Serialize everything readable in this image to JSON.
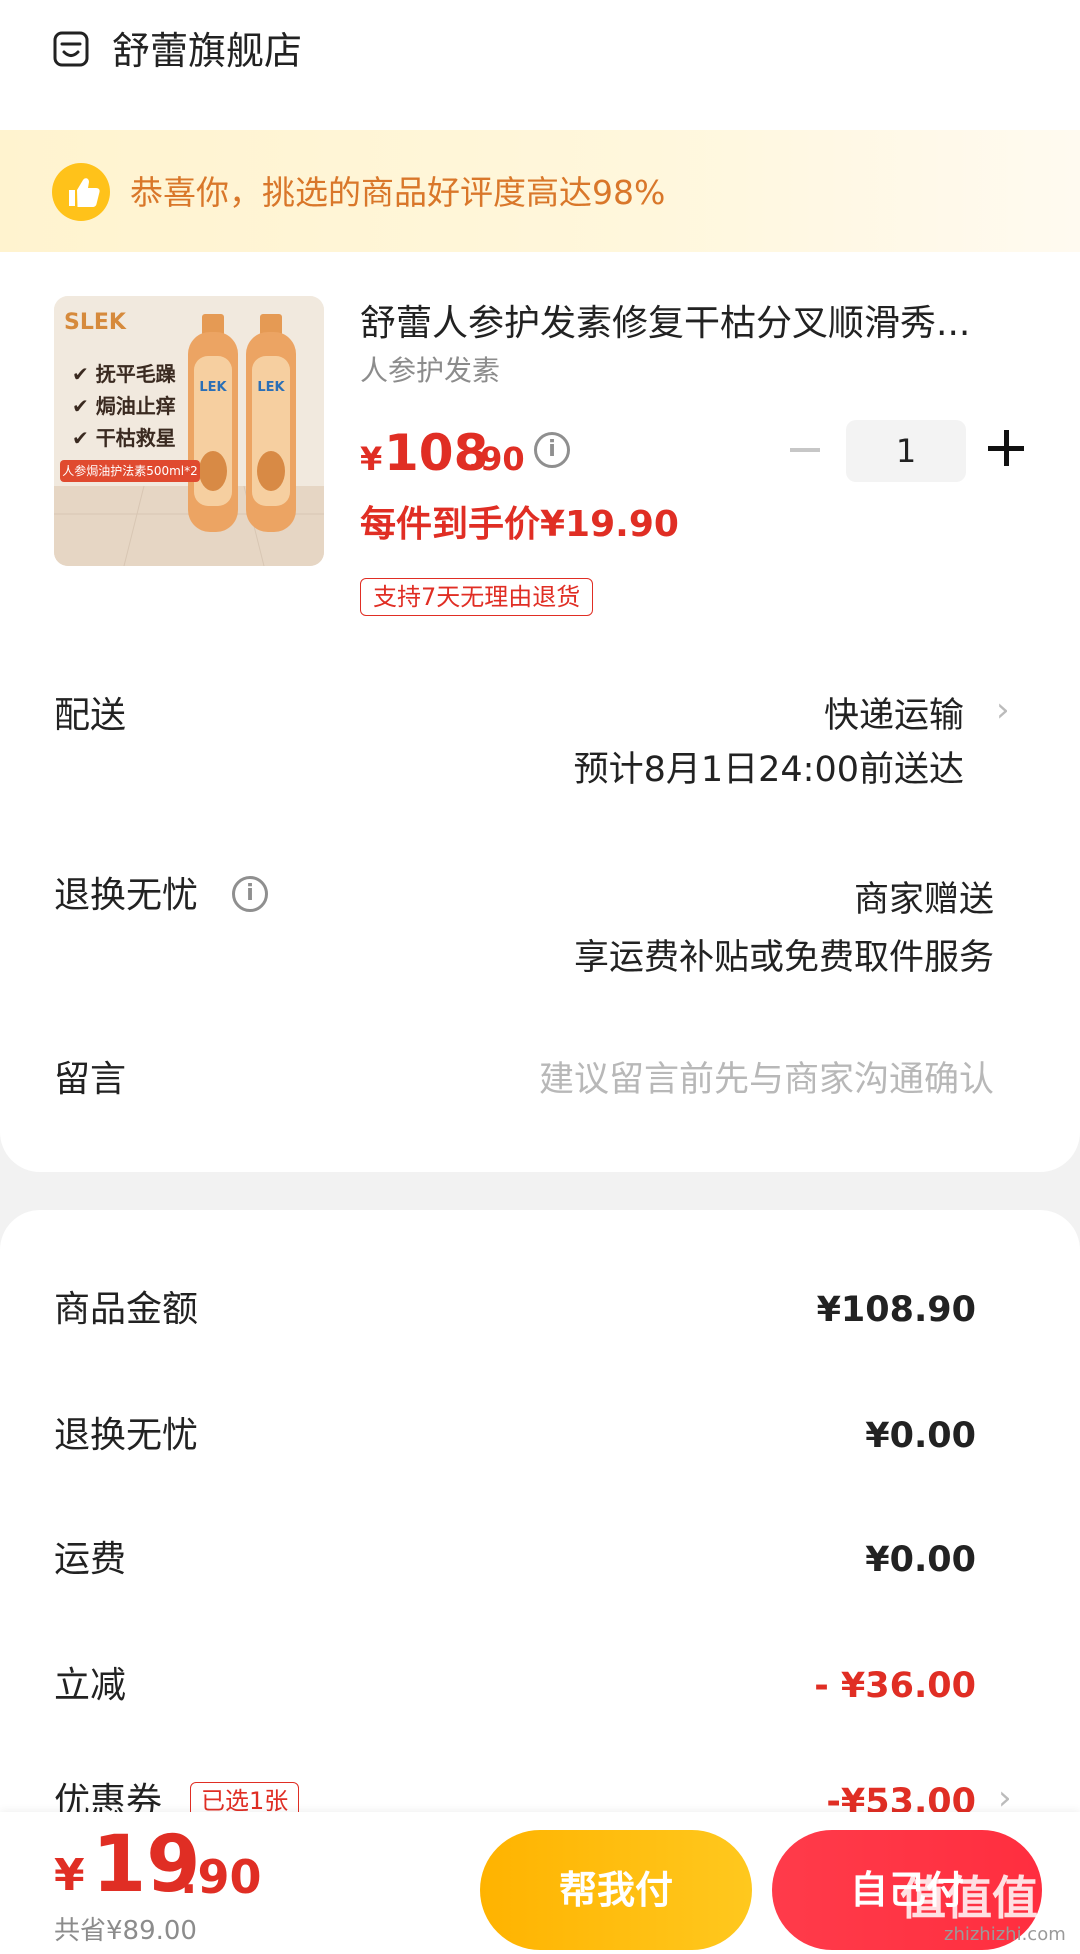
{
  "store": {
    "name": "舒蕾旗舰店",
    "icon": "store-icon"
  },
  "banner": {
    "text": "恭喜你，挑选的商品好评度高达98%",
    "icon": "thumbs-up-icon"
  },
  "product": {
    "title": "舒蕾人参护发素修复干枯分叉顺滑秀...",
    "spec": "人参护发素",
    "price_symbol": "¥",
    "price_int": "108",
    "price_dec": ".90",
    "quantity": "1",
    "unit_price": "每件到手价¥19.90",
    "return_tag": "支持7天无理由退货",
    "image": {
      "brand": "SLEK",
      "bullets": [
        "抚平毛躁",
        "焗油止痒",
        "干枯救星"
      ],
      "strip": "人参焗油护法素500ml*2"
    }
  },
  "delivery": {
    "label": "配送",
    "method": "快递运输",
    "eta": "预计8月1日24:00前送达"
  },
  "return_worry": {
    "label": "退换无忧",
    "value": "商家赠送",
    "desc": "享运费补贴或免费取件服务"
  },
  "message": {
    "label": "留言",
    "placeholder": "建议留言前先与商家沟通确认"
  },
  "summary": {
    "rows": [
      {
        "label": "商品金额",
        "value": "¥108.90"
      },
      {
        "label": "退换无忧",
        "value": "¥0.00"
      },
      {
        "label": "运费",
        "value": "¥0.00"
      },
      {
        "label": "立减",
        "value": "- ¥36.00"
      },
      {
        "label": "优惠券",
        "tag": "已选1张",
        "value": "-¥53.00"
      }
    ]
  },
  "bottom": {
    "total_symbol": "¥",
    "total_int": "19",
    "total_dec": ".90",
    "saved": "共省¥89.00",
    "help_pay": "帮我付",
    "self_pay": "自己付",
    "watermark": "值值值",
    "watermark_url": "zhizhizhi.com"
  },
  "colors": {
    "accent": "#e02e24",
    "help_btn": "#ffb300",
    "self_btn": "#ff3344",
    "banner_text": "#d9772a"
  }
}
